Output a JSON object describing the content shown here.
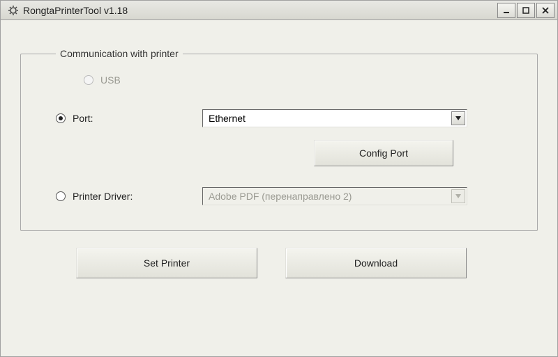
{
  "window": {
    "title": "RongtaPrinterTool v1.18"
  },
  "group": {
    "legend": "Communication with printer",
    "usb_label": "USB",
    "port_label": "Port:",
    "port_value": "Ethernet",
    "config_port_label": "Config Port",
    "driver_label": "Printer Driver:",
    "driver_value": "Adobe PDF (перенаправлено 2)"
  },
  "buttons": {
    "set_printer": "Set Printer",
    "download": "Download"
  }
}
